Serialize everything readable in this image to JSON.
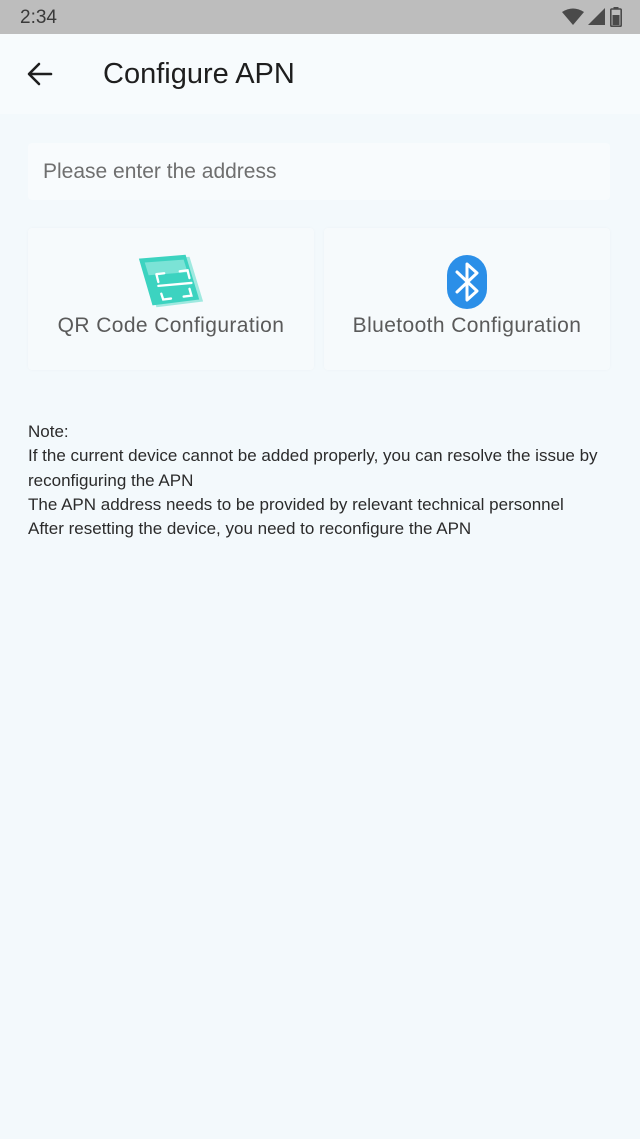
{
  "status_bar": {
    "time": "2:34",
    "icons": [
      "wifi-icon",
      "signal-icon",
      "battery-icon"
    ]
  },
  "header": {
    "back_icon": "arrow-left-icon",
    "title": "Configure APN"
  },
  "address_input": {
    "value": "",
    "placeholder": "Please enter the address"
  },
  "options": [
    {
      "icon": "qr-code-icon",
      "label": "QR Code Configuration",
      "icon_color": "#3cd3c0"
    },
    {
      "icon": "bluetooth-icon",
      "label": "Bluetooth Configuration",
      "icon_color": "#2b8fe8"
    }
  ],
  "note": {
    "heading": "Note:",
    "lines": [
      "If the current device cannot be added properly, you can resolve the issue by reconfiguring the APN",
      "The APN address needs to be provided by relevant technical personnel",
      "After resetting the device, you need to reconfigure the APN"
    ]
  },
  "colors": {
    "background": "#f3f9fc",
    "status_bar": "#bdbdbd",
    "qr_accent": "#3cd3c0",
    "bluetooth_accent": "#2b8fe8"
  }
}
